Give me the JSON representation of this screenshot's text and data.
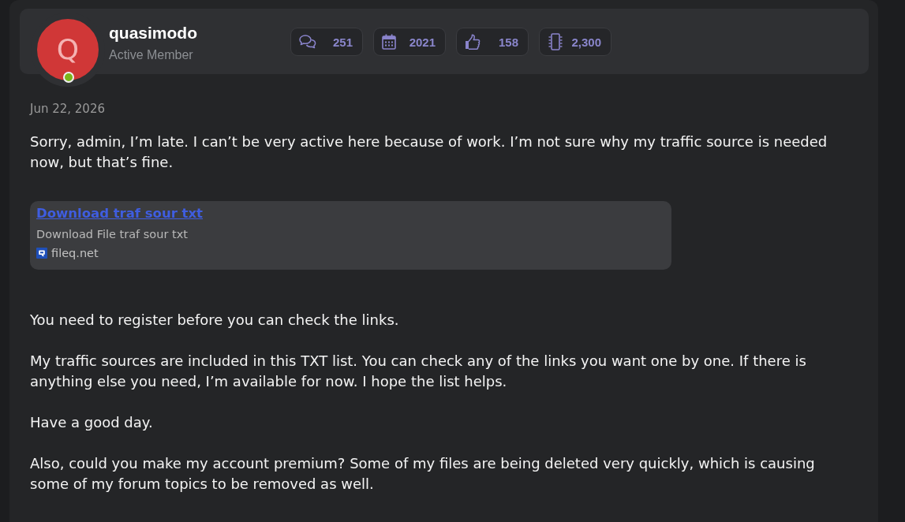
{
  "post": {
    "author": {
      "avatar_letter": "Q",
      "name": "quasimodo",
      "title": "Active Member",
      "online": true
    },
    "stats": [
      {
        "kind": "chat",
        "value": "251"
      },
      {
        "kind": "calendar",
        "value": "2021"
      },
      {
        "kind": "thumb",
        "value": "158"
      },
      {
        "kind": "chip",
        "value": "2,300"
      }
    ],
    "date": "Jun 22, 2026",
    "intro": "Sorry, admin, I’m late. I can’t be very active here because of work. I’m not sure why my traffic source is needed now, but that’s fine.",
    "link_preview": {
      "title": "Download traf sour txt",
      "description": "Download File traf sour txt",
      "site": "fileq.net"
    },
    "paragraphs": [
      "You need to register before you can check the links.",
      "My traffic sources are included in this TXT list. You can check any of the links you want one by one. If there is anything else you need, I’m available for now. I hope the list helps.",
      "Have a good day.",
      "Also, could you make my account premium? Some of my files are being deleted very quickly, which is causing some of my forum topics to be removed as well."
    ]
  }
}
